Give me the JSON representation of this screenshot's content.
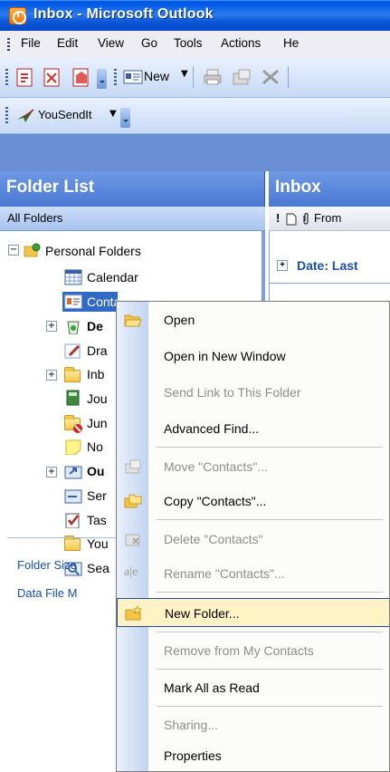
{
  "window": {
    "title": "Inbox - Microsoft Outlook"
  },
  "menubar": {
    "items": [
      "File",
      "Edit",
      "View",
      "Go",
      "Tools",
      "Actions",
      "He"
    ]
  },
  "toolbar": {
    "new_label": "New",
    "yousendit_label": "YouSendIt"
  },
  "folder_list": {
    "title": "Folder List",
    "subheader": "All Folders",
    "root": "Personal Folders",
    "items": [
      "Calendar",
      "Contacts",
      "De",
      "Dra",
      "Inb",
      "Jou",
      "Jun",
      "No",
      "Ou",
      "Ser",
      "Tas",
      "You",
      "Sea"
    ],
    "links": [
      "Folder Size",
      "Data File M"
    ]
  },
  "inbox": {
    "title": "Inbox",
    "column_from": "From",
    "group_label": "Date: Last"
  },
  "context_menu": {
    "items": [
      {
        "label": "Open",
        "enabled": true
      },
      {
        "label": "Open in New Window",
        "enabled": true
      },
      {
        "label": "Send Link to This Folder",
        "enabled": false
      },
      {
        "label": "Advanced Find...",
        "enabled": true
      },
      {
        "label": "Move \"Contacts\"...",
        "enabled": false
      },
      {
        "label": "Copy \"Contacts\"...",
        "enabled": true
      },
      {
        "label": "Delete \"Contacts\"",
        "enabled": false
      },
      {
        "label": "Rename \"Contacts\"...",
        "enabled": false
      },
      {
        "label": "New Folder...",
        "enabled": true,
        "highlighted": true
      },
      {
        "label": "Remove from My Contacts",
        "enabled": false
      },
      {
        "label": "Mark All as Read",
        "enabled": true
      },
      {
        "label": "Sharing...",
        "enabled": false
      },
      {
        "label": "Properties",
        "enabled": true
      }
    ]
  }
}
